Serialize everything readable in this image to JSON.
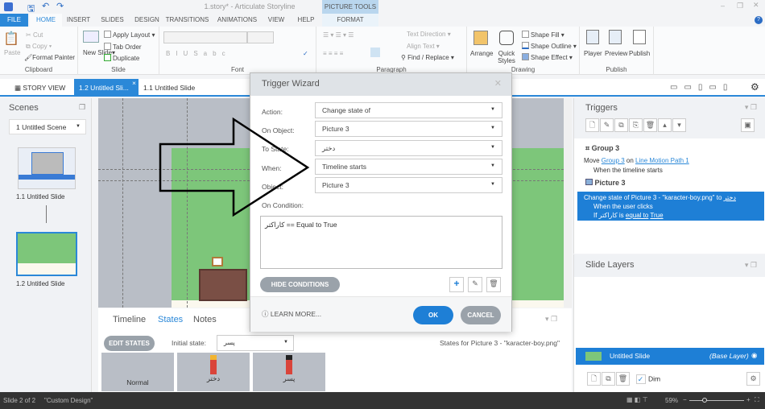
{
  "window": {
    "title": "1.story* - Articulate Storyline",
    "picture_tools": "PICTURE TOOLS",
    "format_tab": "FORMAT"
  },
  "tabs": [
    "FILE",
    "HOME",
    "INSERT",
    "SLIDES",
    "DESIGN",
    "TRANSITIONS",
    "ANIMATIONS",
    "VIEW",
    "HELP"
  ],
  "ribbon": {
    "clipboard": {
      "label": "Clipboard",
      "paste": "Paste",
      "cut": "Cut",
      "copy": "Copy",
      "format_painter": "Format Painter"
    },
    "slide": {
      "label": "Slide",
      "new_slide": "New Slide",
      "apply_layout": "Apply Layout",
      "tab_order": "Tab Order",
      "duplicate": "Duplicate"
    },
    "font": {
      "label": "Font"
    },
    "paragraph": {
      "label": "Paragraph",
      "text_direction": "Text Direction",
      "align_text": "Align Text",
      "find_replace": "Find / Replace"
    },
    "drawing": {
      "label": "Drawing",
      "arrange": "Arrange",
      "quick_styles": "Quick Styles",
      "shape_fill": "Shape Fill",
      "shape_outline": "Shape Outline",
      "shape_effect": "Shape Effect"
    },
    "publish": {
      "label": "Publish",
      "player": "Player",
      "preview": "Preview",
      "publish": "Publish"
    }
  },
  "view_tabs": {
    "story_view": "STORY VIEW",
    "active": "1.2 Untitled Sli...",
    "other": "1.1 Untitled Slide"
  },
  "scenes": {
    "title": "Scenes",
    "selected_scene": "1 Untitled Scene",
    "slides": [
      "1.1 Untitled Slide",
      "1.2 Untitled Slide"
    ]
  },
  "bottom": {
    "tabs": [
      "Timeline",
      "States",
      "Notes"
    ],
    "edit_states": "EDIT STATES",
    "initial_state_label": "Initial state:",
    "initial_state": "پسر",
    "states_for": "States for Picture 3 - \"karacter-boy.png\"",
    "states": [
      "Normal",
      "دختر",
      "پسر"
    ]
  },
  "triggers": {
    "title": "Triggers",
    "groups": [
      {
        "name": "Group 3",
        "lines": [
          {
            "pre": "Move ",
            "link1": "Group 3",
            "mid": " on ",
            "link2": "Line Motion Path 1"
          },
          {
            "text": "When the timeline starts"
          }
        ]
      },
      {
        "name": "Picture 3",
        "selected": {
          "line1": "Change state of Picture 3 - \"karacter-boy.png\" to ",
          "state": "دختر",
          "line2": "When the user clicks",
          "if": "If ",
          "var": "کاراکتر",
          "is": " is ",
          "op": "equal to",
          "val": "True"
        }
      }
    ]
  },
  "layers": {
    "title": "Slide Layers",
    "base_name": "Untitled Slide",
    "base_tag": "(Base Layer)",
    "dim": "Dim"
  },
  "dialog": {
    "title": "Trigger Wizard",
    "fields": [
      {
        "label": "Action:",
        "value": "Change state of"
      },
      {
        "label": "On Object:",
        "value": "Picture 3"
      },
      {
        "label": "To State:",
        "value": "دختر"
      },
      {
        "label": "When:",
        "value": "Timeline starts"
      },
      {
        "label": "Object:",
        "value": "Picture 3"
      }
    ],
    "on_condition": "On Condition:",
    "condition": "کاراکتر == Equal to True",
    "hide_conditions": "HIDE CONDITIONS",
    "learn_more": "LEARN MORE...",
    "ok": "OK",
    "cancel": "CANCEL"
  },
  "status": {
    "slide": "Slide 2 of 2",
    "design": "\"Custom Design\"",
    "zoom": "59%"
  },
  "colors": {
    "accent": "#2b88d8",
    "slide_green": "#7dc67a",
    "status_bar": "#333333"
  }
}
